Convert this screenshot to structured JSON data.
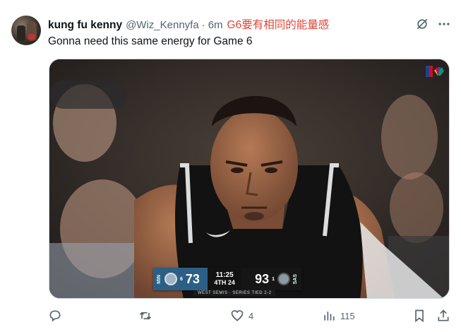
{
  "tweet": {
    "author_name": "kung fu kenny",
    "author_handle": "@Wiz_Kennyfa",
    "separator": "·",
    "time": "6m",
    "annotation": "G6要有相同的能量感",
    "text": "Gonna need this same energy for Game 6"
  },
  "media": {
    "scorebug": {
      "away_label": "MIN",
      "away_seed": "6",
      "away_score": "73",
      "clock": "11:25",
      "period": "4TH",
      "shot_clock": "24",
      "home_score": "93",
      "home_seed": "1",
      "home_label": "SAS",
      "series_text": "WEST SEMIS · SERIES TIED 2-2"
    },
    "network_logo": "NBA · NBC"
  },
  "actions": {
    "reply_count": "",
    "retweet_count": "",
    "like_count": "4",
    "views_count": "115"
  },
  "icons": {
    "grok": "grok-icon",
    "more": "more-icon",
    "reply": "reply-icon",
    "retweet": "retweet-icon",
    "like": "heart-icon",
    "views": "views-icon",
    "bookmark": "bookmark-icon",
    "share": "share-icon"
  },
  "colors": {
    "text": "#0f1419",
    "secondary": "#536471",
    "annotation": "#e0453a",
    "border": "#cfd9de"
  }
}
